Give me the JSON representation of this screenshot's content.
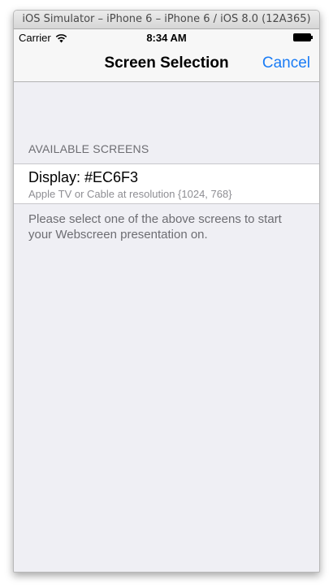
{
  "window": {
    "title": "iOS Simulator – iPhone 6 – iPhone 6 / iOS 8.0 (12A365)"
  },
  "status_bar": {
    "carrier": "Carrier",
    "time": "8:34 AM",
    "icons": [
      "wifi-icon",
      "battery-icon"
    ]
  },
  "nav_bar": {
    "title": "Screen Selection",
    "cancel_label": "Cancel"
  },
  "colors": {
    "accent": "#1a7cf5",
    "background": "#efeff4",
    "secondary_text": "#6d6d72"
  },
  "section": {
    "header": "AVAILABLE SCREENS",
    "items": [
      {
        "title": "Display: #EC6F3",
        "subtitle": "Apple TV or Cable at resolution {1024, 768}"
      }
    ],
    "footer": "Please select one of the above screens to start your Webscreen presentation on."
  }
}
